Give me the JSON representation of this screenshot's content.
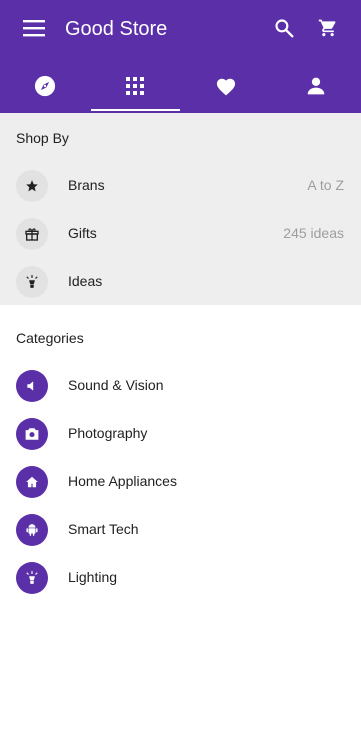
{
  "app": {
    "title": "Good Store"
  },
  "toolbar": {
    "menu_icon": "menu-icon",
    "search_icon": "search-icon",
    "cart_icon": "cart-icon"
  },
  "tabs": [
    {
      "icon": "compass-icon",
      "active": false
    },
    {
      "icon": "grid-icon",
      "active": true
    },
    {
      "icon": "heart-icon",
      "active": false
    },
    {
      "icon": "person-icon",
      "active": false
    }
  ],
  "shop_by": {
    "title": "Shop By",
    "items": [
      {
        "label": "Brans",
        "meta": "A to Z",
        "icon": "star-icon"
      },
      {
        "label": "Gifts",
        "meta": "245 ideas",
        "icon": "gift-icon"
      },
      {
        "label": "Ideas",
        "meta": "",
        "icon": "lightbulb-icon"
      }
    ]
  },
  "categories": {
    "title": "Categories",
    "items": [
      {
        "label": "Sound & Vision",
        "icon": "speaker-icon"
      },
      {
        "label": "Photography",
        "icon": "camera-icon"
      },
      {
        "label": "Home Appliances",
        "icon": "home-icon"
      },
      {
        "label": "Smart Tech",
        "icon": "android-icon"
      },
      {
        "label": "Lighting",
        "icon": "lightbulb-icon"
      }
    ]
  },
  "colors": {
    "primary": "#5b2fa8",
    "surface_grey": "#eeeeee",
    "meta_text": "#9e9e9e"
  }
}
